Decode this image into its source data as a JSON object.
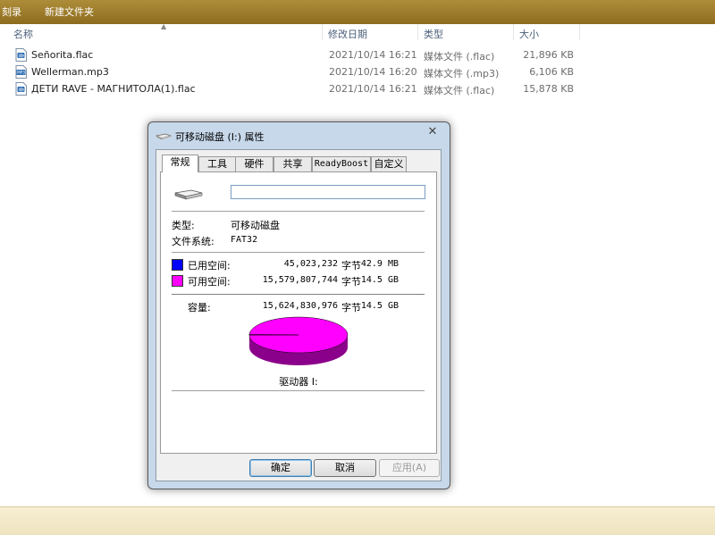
{
  "toolbar": {
    "burn_label": "刻录",
    "new_folder_label": "新建文件夹"
  },
  "columns": {
    "name": "名称",
    "modified": "修改日期",
    "type": "类型",
    "size": "大小"
  },
  "files": [
    {
      "name": "Señorita.flac",
      "modified": "2021/10/14 16:21",
      "type": "媒体文件 (.flac)",
      "size": "21,896 KB",
      "icon": "flac-file-icon"
    },
    {
      "name": "Wellerman.mp3",
      "modified": "2021/10/14 16:20",
      "type": "媒体文件 (.mp3)",
      "size": "6,106 KB",
      "icon": "mp3-file-icon"
    },
    {
      "name": "ДЕТИ RAVE - МАГНИТОЛА(1).flac",
      "modified": "2021/10/14 16:21",
      "type": "媒体文件 (.flac)",
      "size": "15,878 KB",
      "icon": "flac-file-icon"
    }
  ],
  "dialog": {
    "title": "可移动磁盘 (I:) 属性",
    "tabs": [
      "常规",
      "工具",
      "硬件",
      "共享",
      "ReadyBoost",
      "自定义"
    ],
    "active_tab": 0,
    "volume_label_value": "",
    "type_label": "类型:",
    "type_value": "可移动磁盘",
    "fs_label": "文件系统:",
    "fs_value": "FAT32",
    "used": {
      "label": "已用空间:",
      "bytes": "45,023,232",
      "unit": "字节",
      "human": "42.9 MB",
      "color": "#0000ff"
    },
    "free": {
      "label": "可用空间:",
      "bytes": "15,579,807,744",
      "unit": "字节",
      "human": "14.5 GB",
      "color": "#ff00ff"
    },
    "capacity": {
      "label": "容量:",
      "bytes": "15,624,830,976",
      "unit": "字节",
      "human": "14.5 GB"
    },
    "used_fraction": 0.0029,
    "drive_label": "驱动器 I:",
    "buttons": {
      "ok": "确定",
      "cancel": "取消",
      "apply": "应用(A)"
    }
  }
}
